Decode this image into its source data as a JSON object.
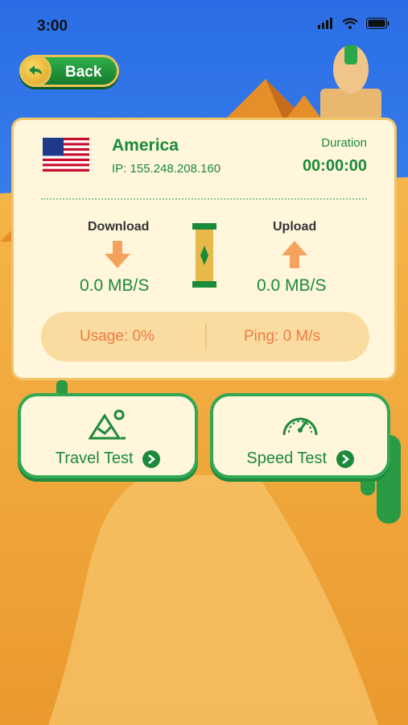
{
  "status_bar": {
    "time": "3:00"
  },
  "header": {
    "back_label": "Back"
  },
  "connection": {
    "country": "America",
    "ip": "IP: 155.248.208.160",
    "duration_label": "Duration",
    "duration_value": "00:00:00"
  },
  "speed": {
    "download_label": "Download",
    "download_value": "0.0 MB/S",
    "upload_label": "Upload",
    "upload_value": "0.0 MB/S"
  },
  "stats": {
    "usage": "Usage: 0%",
    "ping": "Ping: 0 M/s"
  },
  "actions": [
    {
      "label": "Travel Test",
      "icon": "mountain-icon"
    },
    {
      "label": "Speed Test",
      "icon": "speedometer-icon"
    }
  ],
  "colors": {
    "accent_green": "#1b8a3a",
    "orange": "#ee7b45",
    "card_bg": "#fff6dc",
    "sky_blue": "#2f7de8",
    "sand": "#f0a23a"
  }
}
